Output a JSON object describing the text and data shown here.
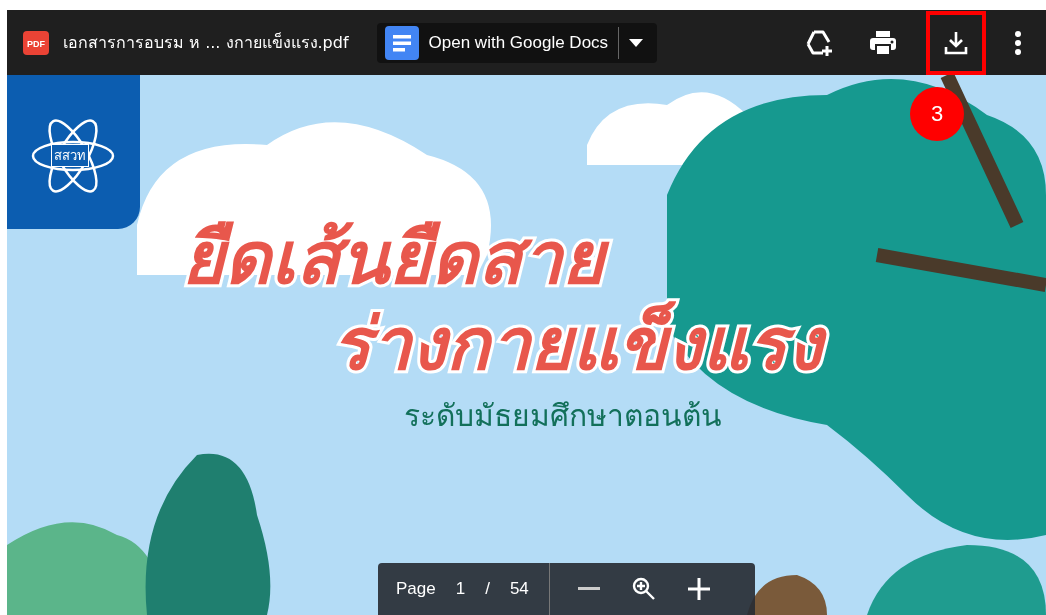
{
  "toolbar": {
    "file_type_label": "PDF",
    "file_name": "เอกสารการอบรม ห ... งกายแข็งแรง.pdf",
    "open_with_button": "Open with Google Docs"
  },
  "annotation": {
    "step_badge": "3"
  },
  "document": {
    "logo_text": "สสวท",
    "title_lines": [
      "ยืดเส้นยืดสาย",
      "ร่างกายแข็งแรง"
    ],
    "subtitle": "ระดับมัธยมศึกษาตอนต้น"
  },
  "page_controls": {
    "page_label": "Page",
    "current_page": "1",
    "separator": "/",
    "total_pages": "54"
  }
}
